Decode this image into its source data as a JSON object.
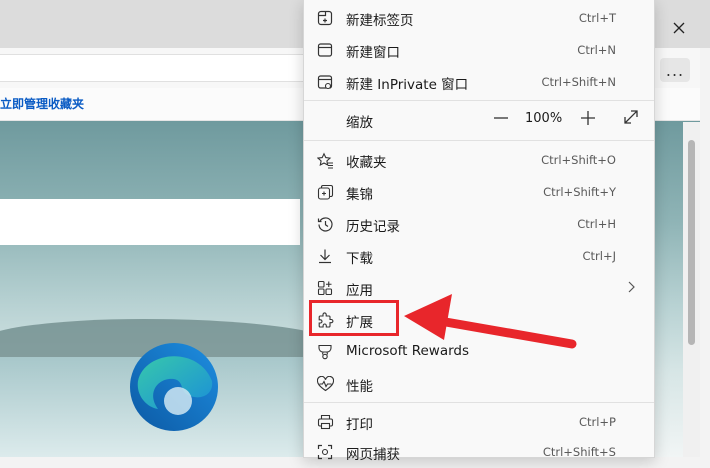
{
  "browser": {
    "favorites_bar_link": "立即管理收藏夹",
    "more_button": "..."
  },
  "menu": {
    "items": [
      {
        "label": "新建标签页",
        "shortcut": "Ctrl+T",
        "icon": "new-tab-icon"
      },
      {
        "label": "新建窗口",
        "shortcut": "Ctrl+N",
        "icon": "new-window-icon"
      },
      {
        "label": "新建 InPrivate 窗口",
        "shortcut": "Ctrl+Shift+N",
        "icon": "inprivate-icon"
      },
      {
        "label": "缩放",
        "icon": "none"
      },
      {
        "label": "收藏夹",
        "shortcut": "Ctrl+Shift+O",
        "icon": "favorites-icon"
      },
      {
        "label": "集锦",
        "shortcut": "Ctrl+Shift+Y",
        "icon": "collections-icon"
      },
      {
        "label": "历史记录",
        "shortcut": "Ctrl+H",
        "icon": "history-icon"
      },
      {
        "label": "下载",
        "shortcut": "Ctrl+J",
        "icon": "download-icon"
      },
      {
        "label": "应用",
        "icon": "apps-icon"
      },
      {
        "label": "扩展",
        "icon": "extensions-icon"
      },
      {
        "label": "Microsoft Rewards",
        "icon": "rewards-icon"
      },
      {
        "label": "性能",
        "icon": "performance-icon"
      },
      {
        "label": "打印",
        "shortcut": "Ctrl+P",
        "icon": "print-icon"
      },
      {
        "label": "网页捕获",
        "shortcut": "Ctrl+Shift+S",
        "icon": "capture-icon"
      }
    ],
    "zoom": {
      "value": "100%",
      "minus": "—",
      "plus": "+"
    }
  },
  "colors": {
    "highlight": "#e8262b",
    "link": "#0a5bc4"
  }
}
